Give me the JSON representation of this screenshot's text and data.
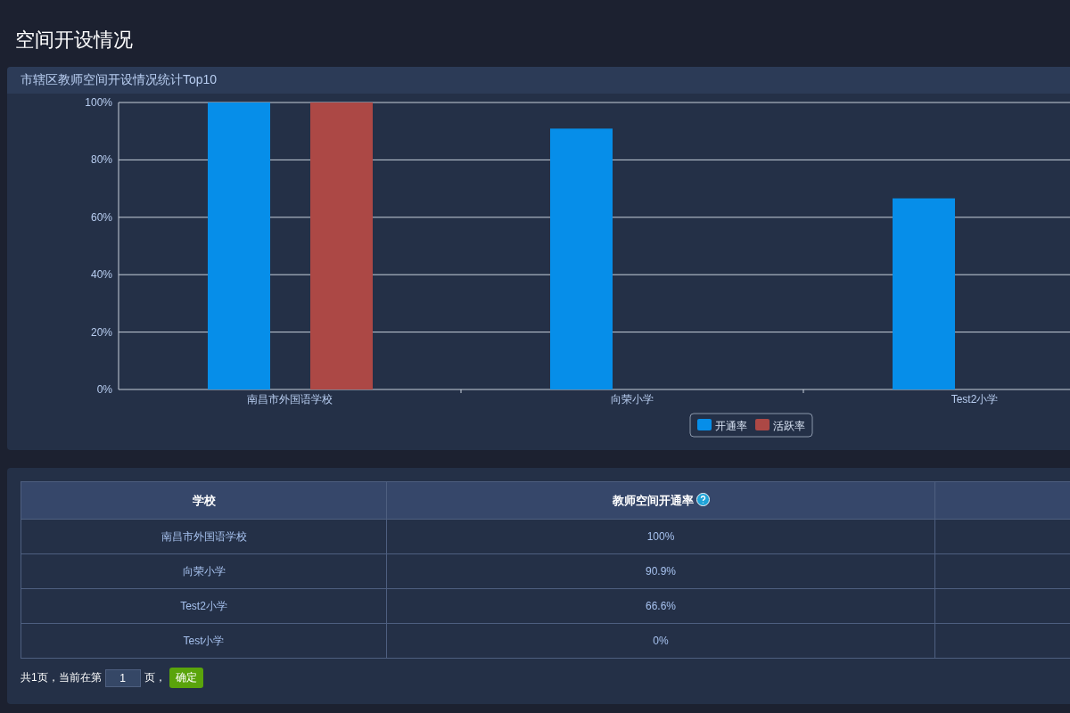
{
  "page_title": "空间开设情况",
  "chart_panel": {
    "title": "市辖区教师空间开设情况统计Top10",
    "chart_data": {
      "type": "bar",
      "categories": [
        "南昌市外国语学校",
        "向荣小学",
        "Test2小学"
      ],
      "series": [
        {
          "name": "开通率",
          "color": "#068ee9",
          "values": [
            100,
            90.9,
            66.6
          ]
        },
        {
          "name": "活跃率",
          "color": "#ac4845",
          "values": [
            100,
            0,
            0
          ]
        }
      ],
      "ylim": [
        0,
        100
      ],
      "grid": true,
      "legend": "bottom",
      "yticks": [
        {
          "value": 0,
          "label": "0%"
        },
        {
          "value": 20,
          "label": "20%"
        },
        {
          "value": 40,
          "label": "40%"
        },
        {
          "value": 60,
          "label": "60%"
        },
        {
          "value": 80,
          "label": "80%"
        },
        {
          "value": 100,
          "label": "100%"
        }
      ]
    }
  },
  "table": {
    "columns": [
      "学校",
      "教师空间开通率"
    ],
    "rows": [
      [
        "南昌市外国语学校",
        "100%"
      ],
      [
        "向荣小学",
        "90.9%"
      ],
      [
        "Test2小学",
        "66.6%"
      ],
      [
        "Test小学",
        "0%"
      ]
    ]
  },
  "pager": {
    "before": "共1页，当前在第",
    "page": "1",
    "after": "页，",
    "confirm": "确定"
  }
}
